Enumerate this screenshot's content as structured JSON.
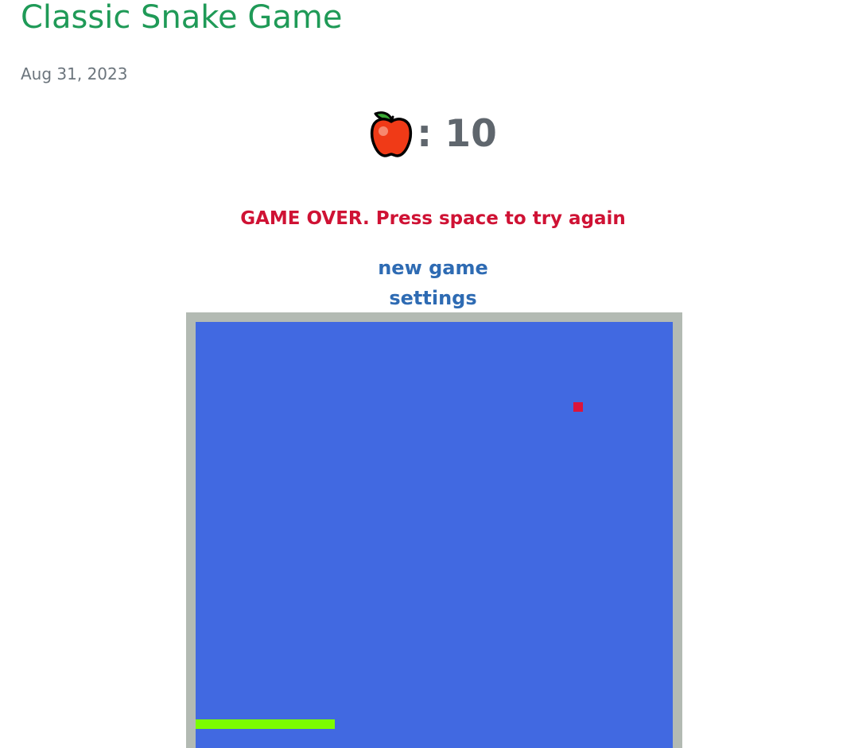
{
  "header": {
    "title": "Classic Snake Game",
    "date": "Aug 31, 2023"
  },
  "score": {
    "icon": "apple-icon",
    "text": ": 10",
    "value": 10
  },
  "status": {
    "message": "GAME OVER. Press space to try again"
  },
  "links": {
    "new_game": "new game",
    "settings": "settings"
  },
  "board": {
    "grid_cell": "snake-game grid",
    "colors": {
      "border": "#b3bab3",
      "background": "#4169e1",
      "food": "#dc143c",
      "snake": "#7cfc00"
    },
    "food": {
      "cell": [
        48,
        10
      ]
    },
    "snake": {
      "segments": [
        [
          0,
          50
        ],
        [
          1,
          50
        ],
        [
          2,
          50
        ],
        [
          3,
          50
        ],
        [
          4,
          50
        ],
        [
          5,
          50
        ],
        [
          6,
          50
        ],
        [
          7,
          50
        ],
        [
          8,
          50
        ],
        [
          9,
          50
        ],
        [
          10,
          50
        ],
        [
          11,
          50
        ],
        [
          12,
          50
        ],
        [
          13,
          50
        ],
        [
          14,
          50
        ],
        [
          15,
          50
        ],
        [
          16,
          50
        ],
        [
          17,
          50
        ]
      ]
    }
  },
  "colors": {
    "title": "#1f9a57",
    "date": "#6c757d",
    "score": "#5f666d",
    "game_over": "#cf1234",
    "link": "#2e6bb3"
  }
}
